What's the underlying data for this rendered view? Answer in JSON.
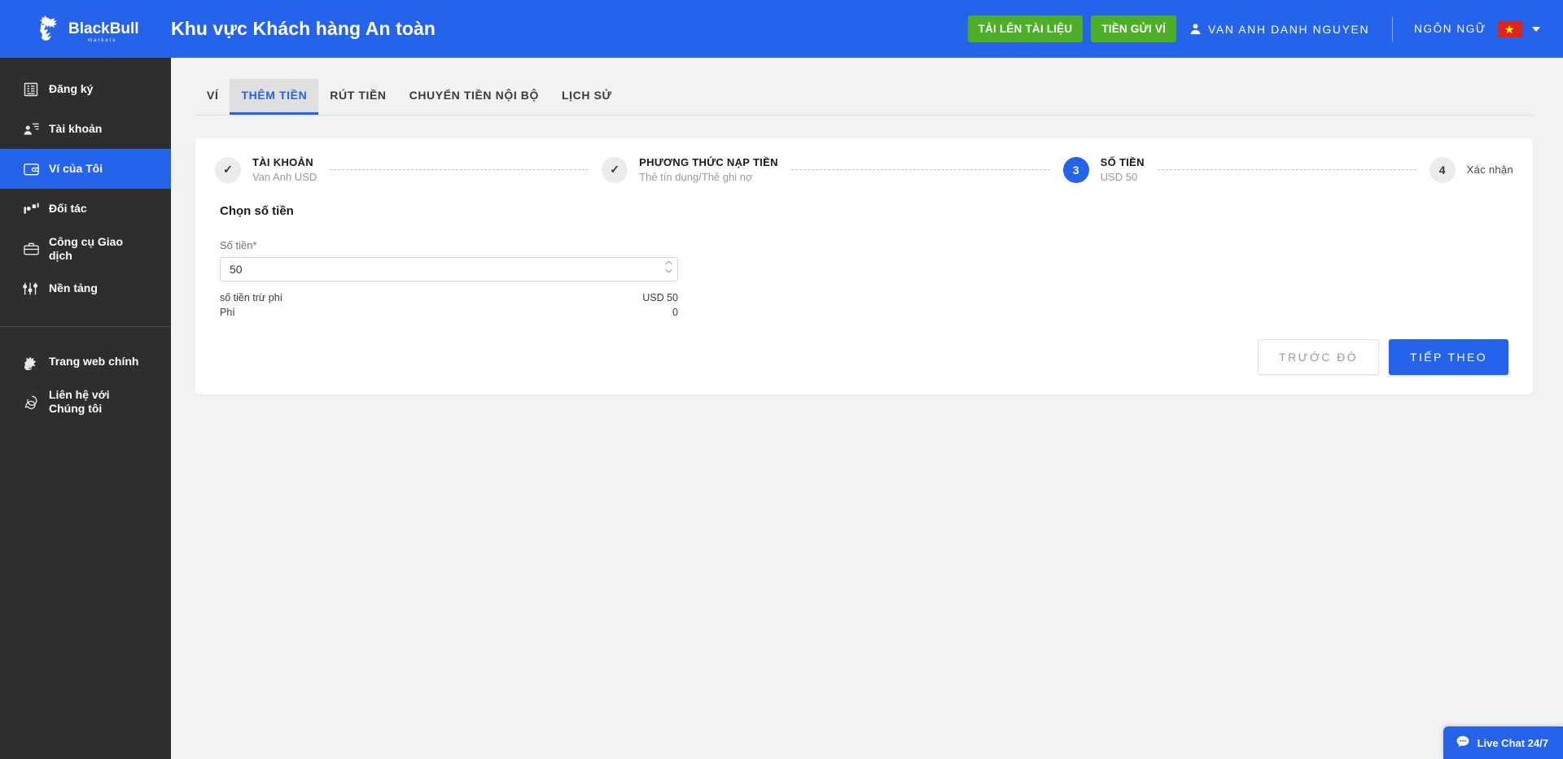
{
  "header": {
    "brand": "BlackBull",
    "brand_sub": "markets",
    "title": "Khu vực Khách hàng An toàn",
    "upload_btn": "TẢI LÊN TÀI LIỆU",
    "deposit_btn": "TIỀN GỬI VÍ",
    "user_name": "VAN ANH DANH NGUYEN",
    "language_label": "NGÔN NGỮ",
    "flag_star": "★",
    "accent_blue": "#2563eb",
    "accent_green": "#4caf27",
    "flag_red": "#da251d"
  },
  "sidebar": {
    "items": [
      {
        "label": "Đăng ký",
        "icon": "document-list-icon",
        "active": false
      },
      {
        "label": "Tài khoản",
        "icon": "user-card-icon",
        "active": false
      },
      {
        "label": "Ví của Tôi",
        "icon": "wallet-icon",
        "active": true
      },
      {
        "label": "Đối tác",
        "icon": "partners-icon",
        "active": false
      },
      {
        "label": "Công cụ Giao dịch",
        "icon": "briefcase-icon",
        "active": false
      },
      {
        "label": "Nền tảng",
        "icon": "sliders-icon",
        "active": false
      }
    ],
    "footer_items": [
      {
        "label": "Trang web chính",
        "icon": "bull-icon"
      },
      {
        "label": "Liên hệ với Chúng tôi",
        "icon": "chat-bubbles-icon"
      }
    ]
  },
  "tabs": [
    {
      "label": "VÍ",
      "active": false
    },
    {
      "label": "THÊM TIỀN",
      "active": true
    },
    {
      "label": "RÚT TIỀN",
      "active": false
    },
    {
      "label": "CHUYỂN TIỀN NỘI BỘ",
      "active": false
    },
    {
      "label": "LỊCH SỬ",
      "active": false
    }
  ],
  "stepper": [
    {
      "marker": "✓",
      "title": "TÀI KHOẢN",
      "sub": "Van Anh USD",
      "state": "done"
    },
    {
      "marker": "✓",
      "title": "PHƯƠNG THỨC NẠP TIỀN",
      "sub": "Thẻ tín dụng/Thẻ ghi nợ",
      "state": "done"
    },
    {
      "marker": "3",
      "title": "SỐ TIỀN",
      "sub": "USD 50",
      "state": "current"
    },
    {
      "marker": "4",
      "title": "Xác nhận",
      "sub": "",
      "state": "upcoming"
    }
  ],
  "form": {
    "heading": "Chọn số tiền",
    "amount_label": "Số tiền*",
    "amount_value": "50",
    "amount_placeholder": "0",
    "rows": [
      {
        "label": "số tiền trừ phí",
        "value": "USD 50"
      },
      {
        "label": "Phí",
        "value": "0"
      }
    ],
    "prev_btn": "TRƯỚC ĐÓ",
    "next_btn": "TIẾP THEO"
  },
  "live_chat": {
    "label": "Live Chat 24/7",
    "icon": "chat-bubble-icon"
  }
}
